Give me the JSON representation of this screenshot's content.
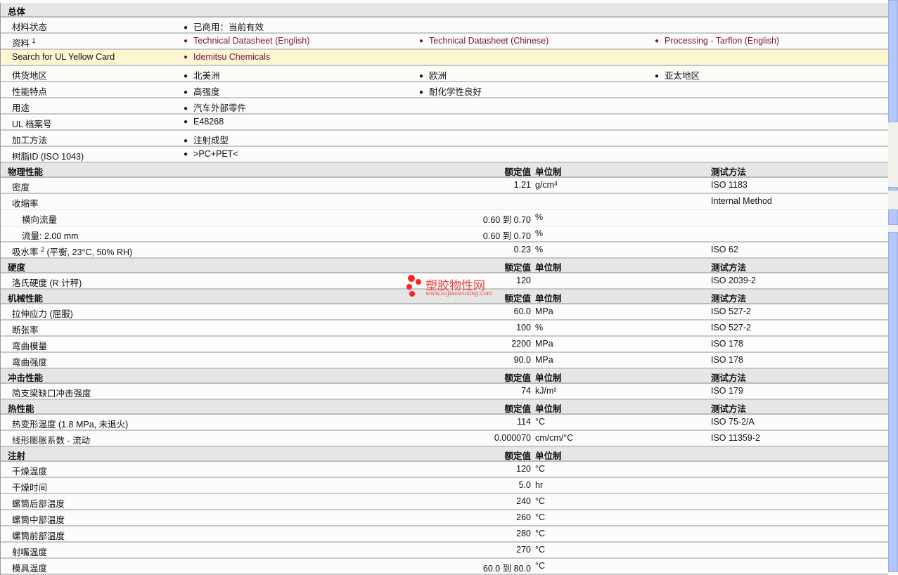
{
  "sections": [
    {
      "title": "总体",
      "kind": "general",
      "rows": [
        {
          "label": "材料状态",
          "items": [
            "已商用：当前有效"
          ]
        },
        {
          "label": "资料",
          "sup": "1",
          "items": [
            "Technical Datasheet (English)",
            "Technical Datasheet (Chinese)",
            "Processing - Tarflon (English)"
          ],
          "links": true
        },
        {
          "label": "Search for UL Yellow Card",
          "items": [
            "Idemitsu Chemicals"
          ],
          "links": true,
          "highlight": true
        },
        {
          "label": "供货地区",
          "items": [
            "北美洲",
            "欧洲",
            "亚太地区"
          ]
        },
        {
          "label": "性能特点",
          "items": [
            "高强度",
            "耐化学性良好"
          ]
        },
        {
          "label": "用途",
          "items": [
            "汽车外部零件"
          ]
        },
        {
          "label": "UL 档案号",
          "items": [
            "E48268"
          ]
        },
        {
          "label": "加工方法",
          "items": [
            "注射成型"
          ]
        },
        {
          "label": "树脂ID (ISO 1043)",
          "items": [
            ">PC+PET<"
          ]
        }
      ]
    },
    {
      "title": "物理性能",
      "value_header": "额定值",
      "unit_header": "单位制",
      "test_header": "测试方法",
      "rows": [
        {
          "label": "密度",
          "value": "1.21",
          "unit": "g/cm³",
          "test": "ISO 1183"
        },
        {
          "label": "收缩率",
          "value": "",
          "unit": "",
          "test": "Internal Method",
          "thin": true
        },
        {
          "label": "横向流量",
          "indent": true,
          "value": "0.60 到  0.70",
          "unit": "%",
          "test": "",
          "thin": true
        },
        {
          "label": "流量: 2.00 mm",
          "indent": true,
          "value": "0.60 到  0.70",
          "unit": "%",
          "test": ""
        },
        {
          "label": "吸水率",
          "sup": "2",
          "label_suffix": " (平衡, 23°C, 50% RH)",
          "value": "0.23",
          "unit": "%",
          "test": "ISO 62"
        }
      ]
    },
    {
      "title": "硬度",
      "value_header": "额定值",
      "unit_header": "单位制",
      "test_header": "测试方法",
      "rows": [
        {
          "label": "洛氏硬度 (R 计秤)",
          "value": "120",
          "unit": "",
          "test": "ISO 2039-2"
        }
      ]
    },
    {
      "title": "机械性能",
      "value_header": "额定值",
      "unit_header": "单位制",
      "test_header": "测试方法",
      "rows": [
        {
          "label": "拉伸应力 (屈服)",
          "value": "60.0",
          "unit": "MPa",
          "test": "ISO 527-2"
        },
        {
          "label": "断张率",
          "value": "100",
          "unit": "%",
          "test": "ISO 527-2"
        },
        {
          "label": "弯曲模量",
          "value": "2200",
          "unit": "MPa",
          "test": "ISO 178"
        },
        {
          "label": "弯曲强度",
          "value": "90.0",
          "unit": "MPa",
          "test": "ISO 178"
        }
      ]
    },
    {
      "title": "冲击性能",
      "value_header": "额定值",
      "unit_header": "单位制",
      "test_header": "测试方法",
      "rows": [
        {
          "label": "简支梁缺口冲击强度",
          "value": "74",
          "unit": "kJ/m²",
          "test": "ISO 179"
        }
      ]
    },
    {
      "title": "热性能",
      "value_header": "额定值",
      "unit_header": "单位制",
      "test_header": "测试方法",
      "rows": [
        {
          "label": "热变形温度 (1.8 MPa, 未退火)",
          "value": "114",
          "unit": "°C",
          "test": "ISO 75-2/A"
        },
        {
          "label": "线形膨胀系数 - 流动",
          "value": "0.000070",
          "unit": "cm/cm/°C",
          "test": "ISO 11359-2"
        }
      ]
    },
    {
      "title": "注射",
      "value_header": "额定值",
      "unit_header": "单位制",
      "rows": [
        {
          "label": "干燥温度",
          "value": "120",
          "unit": "°C"
        },
        {
          "label": "干燥时间",
          "value": "5.0",
          "unit": "hr"
        },
        {
          "label": "螺筒后部温度",
          "value": "240",
          "unit": "°C"
        },
        {
          "label": "螺筒中部温度",
          "value": "260",
          "unit": "°C"
        },
        {
          "label": "螺筒前部温度",
          "value": "280",
          "unit": "°C"
        },
        {
          "label": "射嘴温度",
          "value": "270",
          "unit": "°C"
        },
        {
          "label": "模具温度",
          "value": "60.0 到  80.0",
          "unit": "°C"
        }
      ]
    }
  ],
  "watermark": {
    "name": "塑胶物性网",
    "url": "www.sujiaowuxing.com"
  }
}
